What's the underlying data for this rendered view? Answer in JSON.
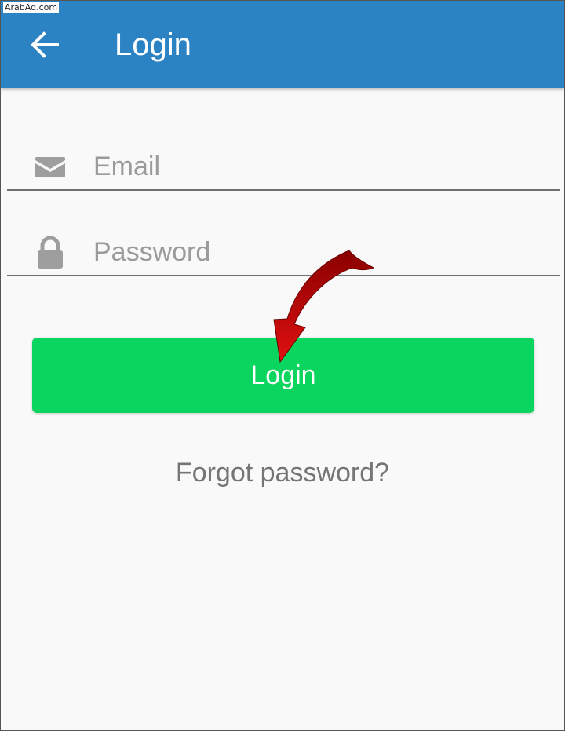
{
  "watermark": "ArabAq.com",
  "appbar": {
    "title": "Login",
    "back_icon": "arrow-left-icon"
  },
  "form": {
    "email": {
      "placeholder": "Email",
      "value": "",
      "icon": "envelope-icon"
    },
    "password": {
      "placeholder": "Password",
      "value": "",
      "icon": "lock-icon"
    },
    "login_label": "Login",
    "forgot_label": "Forgot password?"
  },
  "annotation": {
    "type": "red-curved-arrow",
    "points_to": "login-button"
  },
  "colors": {
    "appbar": "#2c83c3",
    "login_button": "#0ad55e",
    "background": "#f9f9f9",
    "placeholder": "#9b9b9b",
    "icon": "#9e9e9e",
    "link": "#757575",
    "arrow": "#cc0000"
  }
}
